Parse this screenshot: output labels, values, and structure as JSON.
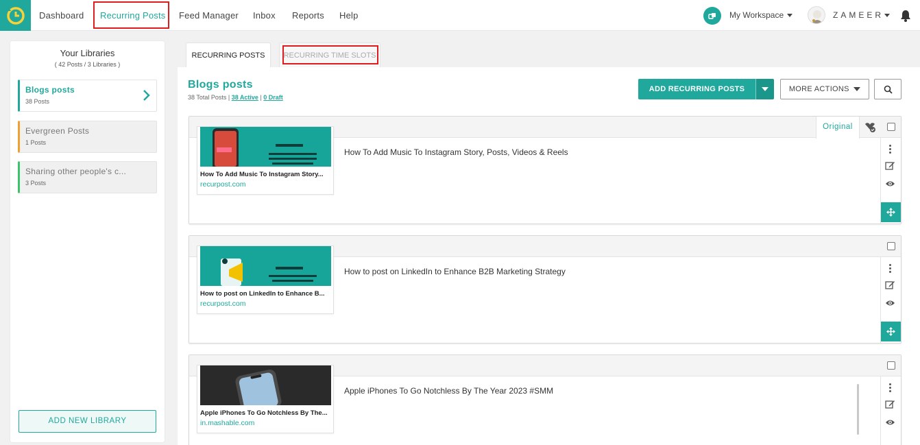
{
  "nav": {
    "items": [
      "Dashboard",
      "Recurring Posts",
      "Feed Manager",
      "Inbox",
      "Reports",
      "Help"
    ],
    "workspace": "My Workspace",
    "user": "ZAMEER"
  },
  "sidebar": {
    "title": "Your Libraries",
    "subtitle": "( 42 Posts / 3 Libraries )",
    "libraries": [
      {
        "name": "Blogs posts",
        "count": "38 Posts"
      },
      {
        "name": "Evergreen Posts",
        "count": "1 Posts"
      },
      {
        "name": "Sharing other people's c...",
        "count": "3 Posts"
      }
    ],
    "add_button": "ADD NEW LIBRARY"
  },
  "tabs": {
    "recurring_posts": "RECURRING POSTS",
    "recurring_time_slots": "RECURRING TIME SLOTS"
  },
  "main": {
    "title": "Blogs posts",
    "total": "38 Total Posts",
    "active": "38 Active",
    "draft": "0 Draft",
    "add_button": "ADD RECURRING POSTS",
    "more_actions": "MORE ACTIONS",
    "original_tab": "Original"
  },
  "posts": [
    {
      "text": "How To Add Music To Instagram Story, Posts, Videos & Reels",
      "preview_title": "How To Add Music To Instagram Story...",
      "url": "recurpost.com"
    },
    {
      "text": "How to post on LinkedIn to Enhance B2B Marketing Strategy",
      "preview_title": "How to post on LinkedIn to Enhance B...",
      "url": "recurpost.com"
    },
    {
      "text": "Apple iPhones To Go Notchless By The Year 2023 #SMM",
      "preview_title": "Apple iPhones To Go Notchless By The...",
      "url": "in.mashable.com"
    }
  ],
  "colors": {
    "accent": "#1fa89b",
    "highlight": "#e01b1b"
  }
}
